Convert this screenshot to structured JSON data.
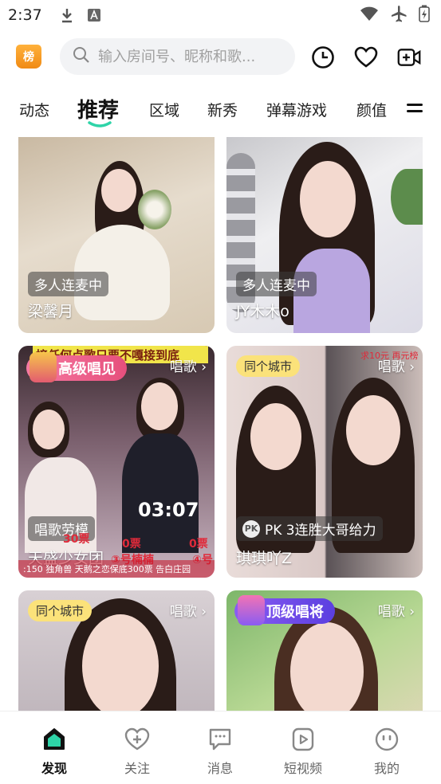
{
  "status_bar": {
    "time": "2:37"
  },
  "header": {
    "rank_badge": "榜",
    "search_placeholder": "输入房间号、昵称和歌...",
    "icons": [
      "history-icon",
      "heart-icon",
      "video-camera-icon"
    ]
  },
  "tabs": [
    {
      "label": "动态"
    },
    {
      "label": "推荐",
      "active": true
    },
    {
      "label": "区域"
    },
    {
      "label": "新秀"
    },
    {
      "label": "弹幕游戏"
    },
    {
      "label": "颜值"
    }
  ],
  "cards": [
    {
      "tag": "多人连麦中",
      "name": "梁馨月"
    },
    {
      "tag": "多人连麦中",
      "name": "JY木木o"
    },
    {
      "banner": "接任何点歌只要不嘎接到底",
      "badge": "高级唱见",
      "category": "唱歌",
      "timer": "03:07",
      "tag": "唱歌劳模",
      "name": "天盛少女团",
      "scores": [
        "30票",
        "0票",
        "0票"
      ],
      "singers": [
        "③号楠楠",
        "④号"
      ],
      "ticker": ":150 独角兽  天鹅之恋保底300票  告白庄园"
    },
    {
      "city_tag": "同个城市",
      "category": "唱歌",
      "pk_label": "PK 3连胜大哥给力",
      "name": "琪琪吖Z",
      "overlay": "求10元 再元榜"
    },
    {
      "city_tag": "同个城市",
      "category": "唱歌"
    },
    {
      "badge": "顶级唱将",
      "category": "唱歌"
    }
  ],
  "bottom_nav": [
    {
      "label": "发现",
      "icon": "home-icon",
      "active": true
    },
    {
      "label": "关注",
      "icon": "heart-plus-icon"
    },
    {
      "label": "消息",
      "icon": "message-icon"
    },
    {
      "label": "短视频",
      "icon": "play-icon"
    },
    {
      "label": "我的",
      "icon": "profile-face-icon"
    }
  ],
  "colors": {
    "accent": "#2ed4a8",
    "badge_orange": "#f29a1e",
    "city_tag": "#fbe27a",
    "badge_pink": "#f05a8a",
    "badge_purple": "#7a4df0"
  }
}
